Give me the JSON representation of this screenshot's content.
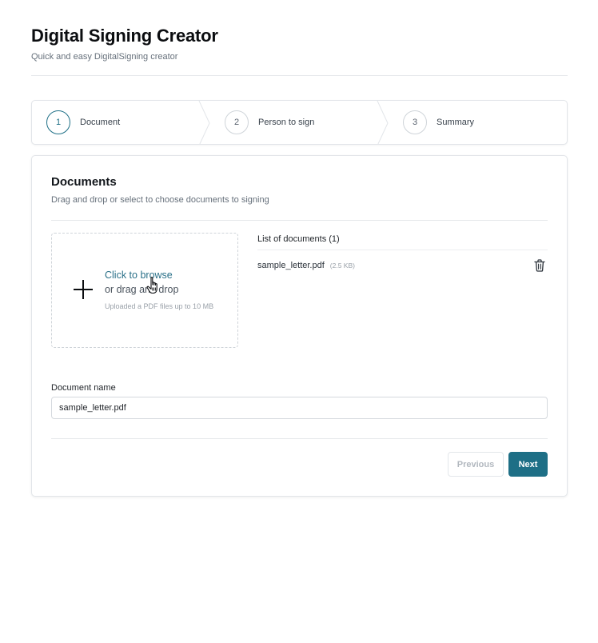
{
  "header": {
    "title": "Digital Signing Creator",
    "subtitle": "Quick and easy DigitalSigning creator"
  },
  "stepper": {
    "active_step": 1,
    "steps": [
      {
        "number": "1",
        "label": "Document"
      },
      {
        "number": "2",
        "label": "Person to sign"
      },
      {
        "number": "3",
        "label": "Summary"
      }
    ]
  },
  "documents": {
    "title": "Documents",
    "subtitle": "Drag and drop or select to choose documents to signing",
    "dropzone": {
      "browse_label": "Click to browse",
      "drag_label": "or drag and drop",
      "hint": "Uploaded a PDF files up to 10 MB"
    },
    "list": {
      "title": "List of documents (1)",
      "items": [
        {
          "name": "sample_letter.pdf",
          "size": "(2.5 KB)"
        }
      ]
    },
    "name_field": {
      "label": "Document name",
      "value": "sample_letter.pdf"
    }
  },
  "actions": {
    "previous_label": "Previous",
    "next_label": "Next"
  },
  "colors": {
    "accent": "#1e6f86",
    "border": "#e2e5e9",
    "muted_text": "#66707b"
  }
}
